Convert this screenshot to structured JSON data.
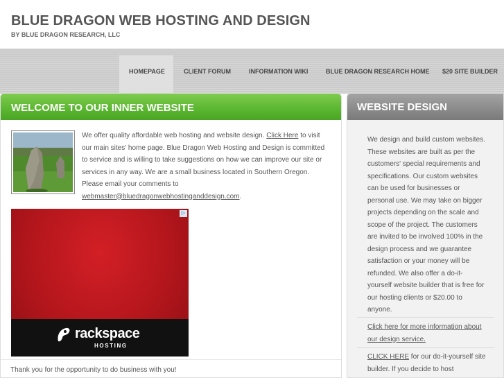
{
  "header": {
    "title": "BLUE DRAGON WEB HOSTING AND DESIGN",
    "subtitle": "BY BLUE DRAGON RESEARCH, LLC"
  },
  "nav": {
    "items": [
      {
        "label": "HOMEPAGE",
        "active": true
      },
      {
        "label": "CLIENT FORUM"
      },
      {
        "label": "INFORMATION WIKI"
      },
      {
        "label": "BLUE DRAGON RESEARCH HOME"
      },
      {
        "label": "$20 SITE BUILDER"
      }
    ]
  },
  "main": {
    "title": "WELCOME TO OUR INNER WEBSITE",
    "intro": {
      "text1": "We offer quality affordable web hosting and website design.  ",
      "link1": "Click Here",
      "text2": " to visit our main sites' home page.  Blue Dragon Web Hosting and Design is committed to service and is willing to take suggestions on how we can improve our site or services in any way.  We are a small business located in Southern Oregon.  Please email your comments to ",
      "email": "webmaster@bluedragonwebhostinganddesign.com",
      "text3": "."
    },
    "ad": {
      "brand": "rackspace",
      "tagline": "HOSTING"
    },
    "footer": "Thank you for the opportunity to do business with you!"
  },
  "sidebar": {
    "title": "WEBSITE DESIGN",
    "body": "We design and build custom websites.  These websites are built as per the customers' special requirements and specifications.  Our custom websites  can be used for businesses or personal use.  We may take on bigger projects depending on the scale and scope of the project.  The customers are invited to be involved 100% in the design process and we guarantee satisfaction or your money will be refunded.  We also offer a do-it-yourself website builder that is free for our hosting clients or $20.00 to anyone.",
    "link_more": "Click here for more information about our  design service.",
    "click_here": "CLICK HERE",
    "builder_text": " for our do-it-yourself site builder.  If you decide to host"
  },
  "colors": {
    "main_header": "#5db832",
    "side_header": "#8c8c8c",
    "ad_red": "#c0181f"
  }
}
